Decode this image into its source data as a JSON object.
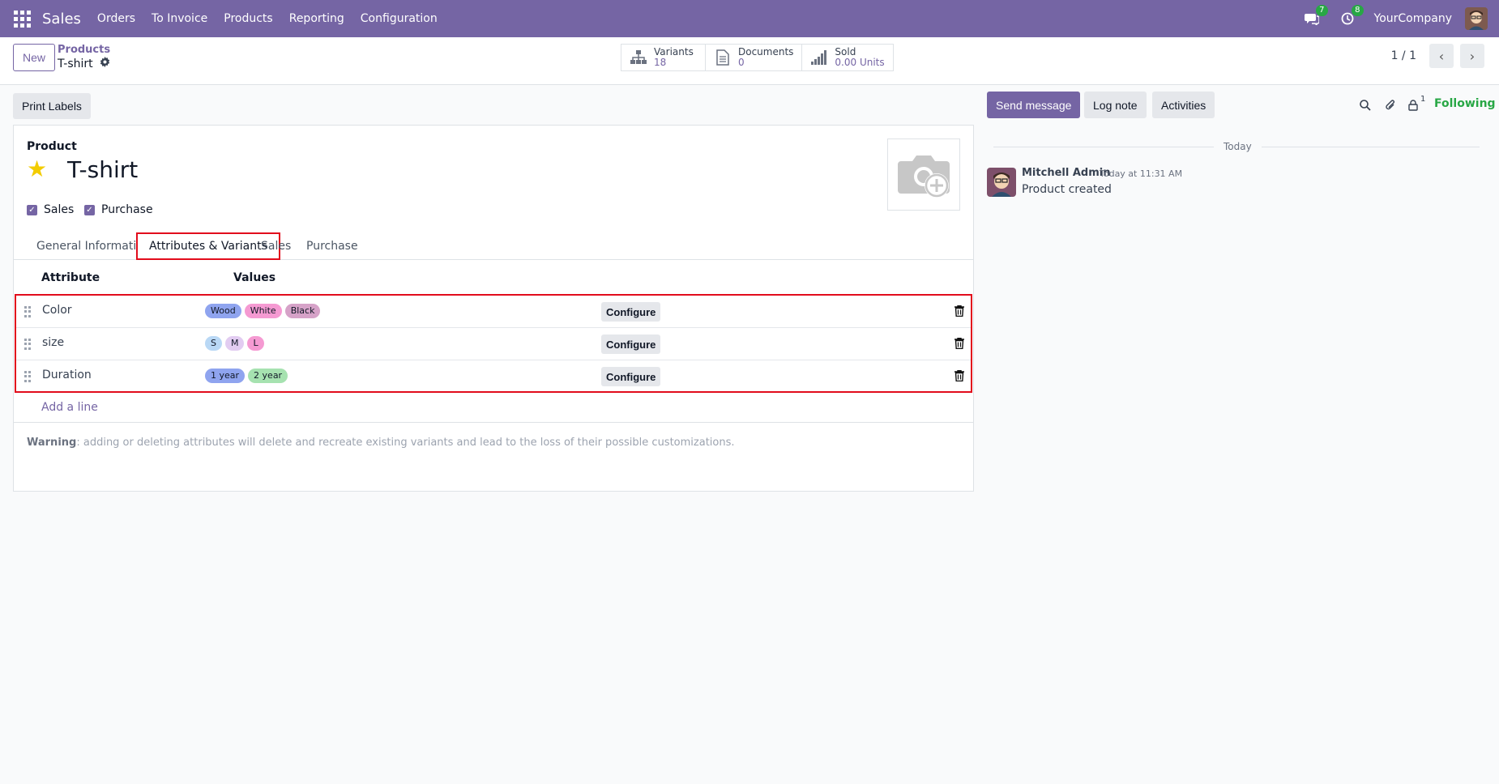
{
  "navbar": {
    "app_name": "Sales",
    "menu": [
      "Orders",
      "To Invoice",
      "Products",
      "Reporting",
      "Configuration"
    ],
    "messages_badge": "7",
    "activities_badge": "8",
    "company": "YourCompany"
  },
  "control": {
    "new_label": "New",
    "breadcrumb_parent": "Products",
    "breadcrumb_current": "T-shirt",
    "stats": [
      {
        "label": "Variants",
        "value": "18",
        "icon": "sitemap-icon"
      },
      {
        "label": "Documents",
        "value": "0",
        "icon": "document-icon"
      },
      {
        "label": "Sold",
        "value": "0.00 Units",
        "icon": "signal-icon"
      }
    ],
    "pager": "1 / 1"
  },
  "form": {
    "print_labels": "Print Labels",
    "product_label": "Product",
    "name": "T-shirt",
    "checkboxes": [
      {
        "label": "Sales",
        "checked": true
      },
      {
        "label": "Purchase",
        "checked": true
      }
    ],
    "tabs": [
      "General Information",
      "Attributes & Variants",
      "Sales",
      "Purchase"
    ],
    "active_tab": "Attributes & Variants",
    "columns": {
      "attribute": "Attribute",
      "values": "Values"
    },
    "rows": [
      {
        "attribute": "Color",
        "values": [
          {
            "label": "Wood",
            "color": "#8fa4ef"
          },
          {
            "label": "White",
            "color": "#f59ad2"
          },
          {
            "label": "Black",
            "color": "#d6a2c8"
          }
        ],
        "configure": "Configure"
      },
      {
        "attribute": "size",
        "values": [
          {
            "label": "S",
            "color": "#b9d8f5"
          },
          {
            "label": "M",
            "color": "#e2ccf1"
          },
          {
            "label": "L",
            "color": "#f59ad2"
          }
        ],
        "configure": "Configure"
      },
      {
        "attribute": "Duration",
        "values": [
          {
            "label": "1 year",
            "color": "#8fa4ef"
          },
          {
            "label": "2 year",
            "color": "#a6e2b0"
          }
        ],
        "configure": "Configure"
      }
    ],
    "add_line": "Add a line",
    "warning_bold": "Warning",
    "warning_text": ": adding or deleting attributes will delete and recreate existing variants and lead to the loss of their possible customizations."
  },
  "chatter": {
    "send_message": "Send message",
    "log_note": "Log note",
    "activities": "Activities",
    "followers_count": "1",
    "following": "Following",
    "day": "Today",
    "message": {
      "author": "Mitchell Admin",
      "time": "Today at 11:31 AM",
      "body": "Product created"
    }
  },
  "colors": {
    "primary": "#7565a4",
    "highlight": "#e20c1c",
    "star": "#f3cc00",
    "following": "#28a745"
  }
}
